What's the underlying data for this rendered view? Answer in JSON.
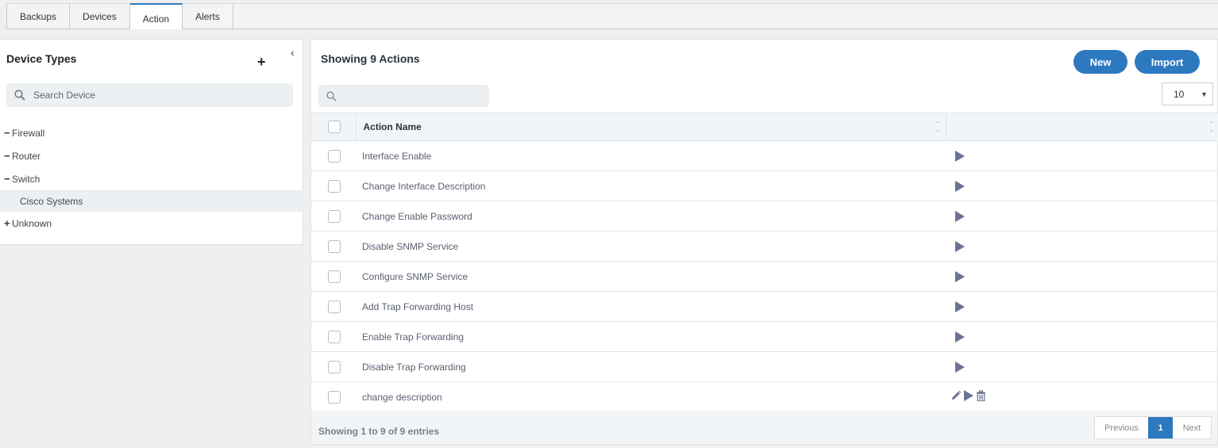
{
  "tabs": [
    {
      "label": "Backups",
      "active": false
    },
    {
      "label": "Devices",
      "active": false
    },
    {
      "label": "Action",
      "active": true
    },
    {
      "label": "Alerts",
      "active": false
    }
  ],
  "left_panel": {
    "title": "Device Types",
    "add_icon": "plus-icon",
    "collapse_icon": "chevron-left-icon",
    "search": {
      "placeholder": "Search Device",
      "value": "",
      "icon": "search-icon"
    },
    "tree": [
      {
        "label": "Firewall",
        "toggle": "−",
        "expanded": true,
        "level": 0
      },
      {
        "label": "Router",
        "toggle": "−",
        "expanded": true,
        "level": 0
      },
      {
        "label": "Switch",
        "toggle": "−",
        "expanded": true,
        "level": 0
      },
      {
        "label": "Cisco Systems",
        "toggle": "",
        "selected": true,
        "level": 1
      },
      {
        "label": "Unknown",
        "toggle": "+",
        "expanded": false,
        "level": 0
      }
    ]
  },
  "main": {
    "title": "Showing 9 Actions",
    "new_label": "New",
    "import_label": "Import",
    "search": {
      "placeholder": "",
      "value": "",
      "icon": "search-icon"
    },
    "page_size": "10",
    "table": {
      "columns": [
        "",
        "Action Name",
        ""
      ],
      "rows": [
        {
          "name": "Interface Enable",
          "actions": [
            "run"
          ]
        },
        {
          "name": "Change Interface Description",
          "actions": [
            "run"
          ]
        },
        {
          "name": "Change Enable Password",
          "actions": [
            "run"
          ]
        },
        {
          "name": "Disable SNMP Service",
          "actions": [
            "run"
          ]
        },
        {
          "name": "Configure SNMP Service",
          "actions": [
            "run"
          ]
        },
        {
          "name": "Add Trap Forwarding Host",
          "actions": [
            "run"
          ]
        },
        {
          "name": "Enable Trap Forwarding",
          "actions": [
            "run"
          ]
        },
        {
          "name": "Disable Trap Forwarding",
          "actions": [
            "run"
          ]
        },
        {
          "name": "change description",
          "actions": [
            "edit",
            "run",
            "delete"
          ]
        }
      ]
    },
    "footer": {
      "info": "Showing 1 to 9 of 9 entries",
      "previous_label": "Previous",
      "current_page": "1",
      "next_label": "Next"
    }
  },
  "colors": {
    "accent": "#2d79c0",
    "play_icon": "#6b7392"
  }
}
